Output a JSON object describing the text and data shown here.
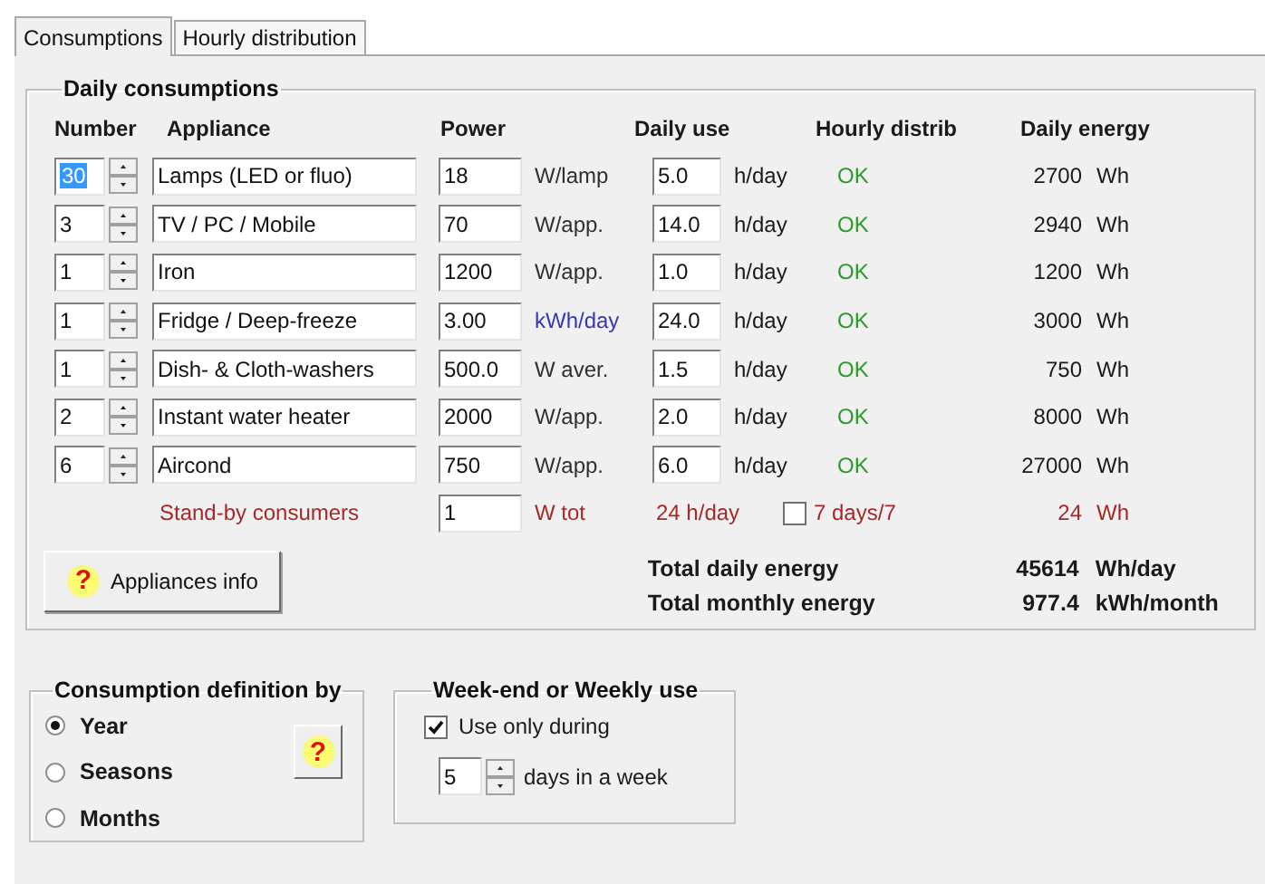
{
  "tabs": [
    {
      "label": "Consumptions",
      "selected": true
    },
    {
      "label": "Hourly distribution",
      "selected": false
    }
  ],
  "daily_consumptions": {
    "title": "Daily consumptions",
    "columns": [
      "Number",
      "Appliance",
      "Power",
      "Daily use",
      "Hourly distrib",
      "Daily energy"
    ],
    "rows": [
      {
        "number": "30",
        "number_selected": true,
        "appliance": "Lamps (LED or fluo)",
        "power": "18",
        "power_unit": "W/lamp",
        "color": "#303030",
        "daily_use": "5.0",
        "use_unit": "h/day",
        "hourly_distrib": "OK",
        "energy": "2700",
        "energy_unit": "Wh"
      },
      {
        "number": "3",
        "number_selected": false,
        "appliance": "TV / PC / Mobile",
        "power": "70",
        "power_unit": "W/app.",
        "color": "#303030",
        "daily_use": "14.0",
        "use_unit": "h/day",
        "hourly_distrib": "OK",
        "energy": "2940",
        "energy_unit": "Wh"
      },
      {
        "number": "1",
        "number_selected": false,
        "appliance": "Iron",
        "power": "1200",
        "power_unit": "W/app.",
        "color": "#303030",
        "daily_use": "1.0",
        "use_unit": "h/day",
        "hourly_distrib": "OK",
        "energy": "1200",
        "energy_unit": "Wh"
      },
      {
        "number": "1",
        "number_selected": false,
        "appliance": "Fridge / Deep-freeze",
        "power": "3.00",
        "power_unit": "kWh/day",
        "color": "#3838b0",
        "daily_use": "24.0",
        "use_unit": "h/day",
        "hourly_distrib": "OK",
        "energy": "3000",
        "energy_unit": "Wh"
      },
      {
        "number": "1",
        "number_selected": false,
        "appliance": "Dish- & Cloth-washers",
        "power": "500.0",
        "power_unit": "W aver.",
        "color": "#303030",
        "daily_use": "1.5",
        "use_unit": "h/day",
        "hourly_distrib": "OK",
        "energy": "750",
        "energy_unit": "Wh"
      },
      {
        "number": "2",
        "number_selected": false,
        "appliance": "Instant water heater",
        "power": "2000",
        "power_unit": "W/app.",
        "color": "#303030",
        "daily_use": "2.0",
        "use_unit": "h/day",
        "hourly_distrib": "OK",
        "energy": "8000",
        "energy_unit": "Wh"
      },
      {
        "number": "6",
        "number_selected": false,
        "appliance": "Aircond",
        "power": "750",
        "power_unit": "W/app.",
        "color": "#303030",
        "daily_use": "6.0",
        "use_unit": "h/day",
        "hourly_distrib": "OK",
        "energy": "27000",
        "energy_unit": "Wh"
      }
    ],
    "standby": {
      "label": "Stand-by consumers",
      "power": "1",
      "unit": "W tot",
      "hours": "24 h/day",
      "checkbox": {
        "label": "7 days/7",
        "checked": false
      },
      "energy": "24",
      "energy_unit": "Wh"
    },
    "info_button": {
      "icon_text": "?",
      "label": "Appliances info"
    },
    "totals": [
      {
        "label": "Total daily energy",
        "value": "45614",
        "unit": "Wh/day"
      },
      {
        "label": "Total monthly energy",
        "value": "977.4",
        "unit": "kWh/month"
      }
    ]
  },
  "consumption_definition": {
    "title": "Consumption definition by",
    "options": [
      {
        "label": "Year",
        "selected": true
      },
      {
        "label": "Seasons",
        "selected": false
      },
      {
        "label": "Months",
        "selected": false
      }
    ],
    "help_icon_text": "?"
  },
  "weekly_use": {
    "title": "Week-end or Weekly use",
    "checkbox": {
      "label": "Use only during",
      "checked": true
    },
    "days": "5",
    "days_label": "days in a week"
  }
}
